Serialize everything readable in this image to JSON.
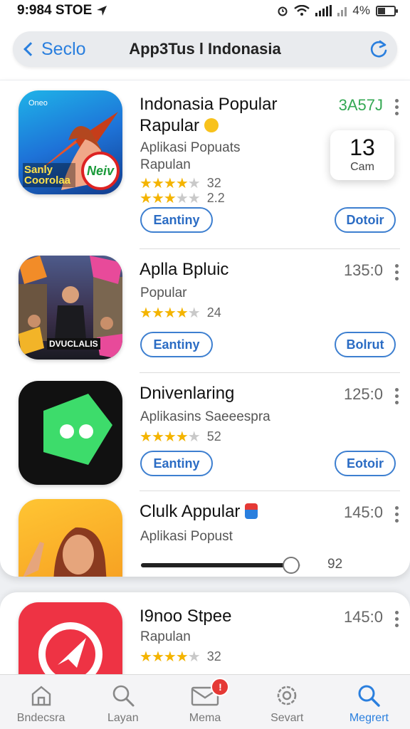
{
  "status_bar": {
    "time": "9:984 STOE",
    "battery": "4%",
    "battery_level": 0.45
  },
  "nav": {
    "back_label": "Seclo",
    "title": "App3Tus l Indonasia"
  },
  "apps": [
    {
      "name": "Indonasia Popular",
      "name_line2": "Rapular",
      "subtitle": "Aplikasi Popuats",
      "subtitle_line2": "Rapulan",
      "rating_a": {
        "stars": 4,
        "count": "32"
      },
      "rating_b": {
        "stars": 3,
        "count": "2.2"
      },
      "price": "3A57J",
      "price_color": "#34a853",
      "left_button": "Eantiny",
      "right_button": "Dotoir",
      "icon_text": "Sanly Coorolaa",
      "icon_badge": "Neiv",
      "icon_brand": "Oneo"
    },
    {
      "name": "Aplla Bpluic",
      "subtitle": "Popular",
      "rating": {
        "stars": 4,
        "count": "24"
      },
      "price": "135:0",
      "left_button": "Eantiny",
      "right_button": "Bolrut",
      "icon_text": "DVUCLALIS"
    },
    {
      "name": "Dnivenlaring",
      "subtitle": "Aplikasins Saeeespra",
      "rating": {
        "stars": 4,
        "count": "52"
      },
      "price": "125:0",
      "left_button": "Eantiny",
      "right_button": "Eotoir"
    },
    {
      "name": "Clulk Appular",
      "subtitle": "Aplikasi Popust",
      "price": "145:0",
      "progress": 0.94,
      "progress_label": "92"
    },
    {
      "name": "I9noo Stpee",
      "subtitle": "Rapulan",
      "rating": {
        "stars": 4,
        "count": "32"
      },
      "price": "145:0"
    }
  ],
  "popup": {
    "number": "13",
    "label": "Cam"
  },
  "tabs": [
    {
      "label": "Bndecsra",
      "icon": "home-icon"
    },
    {
      "label": "Layan",
      "icon": "search-icon"
    },
    {
      "label": "Mema",
      "icon": "mail-icon",
      "badge": "!"
    },
    {
      "label": "Sevart",
      "icon": "gear-icon"
    },
    {
      "label": "Megrert",
      "icon": "search-icon",
      "active": true
    }
  ],
  "colors": {
    "accent": "#2a7fde",
    "star": "#f4b400",
    "badge": "#e53935"
  }
}
